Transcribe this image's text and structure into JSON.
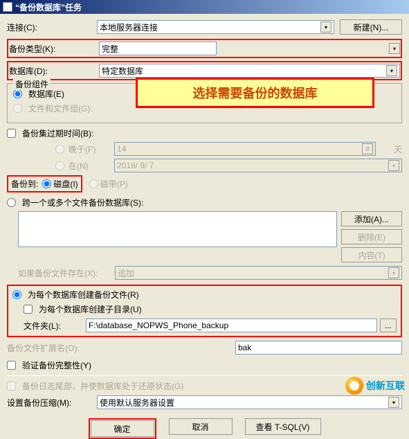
{
  "window": {
    "title": "“备份数据库”任务"
  },
  "rows": {
    "connection": {
      "label": "连接(C):",
      "value": "本地服务器连接",
      "new_btn": "新建(N)..."
    },
    "backup_type": {
      "label": "备份类型(K):",
      "value": "完整"
    },
    "database": {
      "label": "数据库(D):",
      "value": "特定数据库"
    }
  },
  "callout": "选择需要备份的数据库",
  "component": {
    "title": "备份组件",
    "database": "数据库(E)",
    "filegroups": "文件和文件组(G):"
  },
  "expire": {
    "check": "备份集过期时间(B):",
    "after": "晚于(F)",
    "after_val": "14",
    "days": "天",
    "on": "在(N)",
    "on_val": "2018/ 9/ 7"
  },
  "dest": {
    "label": "备份到:",
    "disk": "磁盘(I)",
    "tape": "磁带(P)"
  },
  "multi": {
    "check": "跨一个或多个文件备份数据库(S):",
    "add": "添加(A)...",
    "remove": "删除(E)",
    "contents": "内容(T)",
    "exists_label": "如果备份文件存在(X):",
    "exists_val": "追加"
  },
  "perdb": {
    "create_file": "为每个数据库创建备份文件(R)",
    "create_subdir": "为每个数据库创建子目录(U)",
    "folder_label": "文件夹(L):",
    "folder_val": "F:\\database_NOPWS_Phone_backup",
    "browse": "..."
  },
  "ext": {
    "label": "备份文件扩展名(O):",
    "value": "bak"
  },
  "verify": "验证备份完整性(Y)",
  "tail": "备份日志尾部，并使数据库处于还原状态(G)",
  "compress": {
    "label": "设置备份压缩(M):",
    "value": "使用默认服务器设置"
  },
  "buttons": {
    "ok": "确定",
    "cancel": "取消",
    "tsql": "查看 T-SQL(V)"
  },
  "logo": "创新互联"
}
